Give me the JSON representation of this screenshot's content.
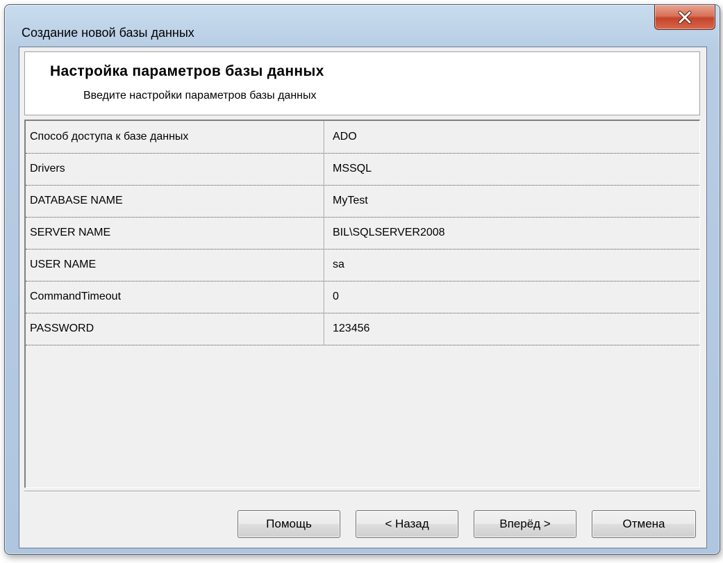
{
  "window": {
    "title": "Создание новой базы данных"
  },
  "header": {
    "title": "Настройка параметров базы данных",
    "subtitle": "Введите настройки параметров базы данных"
  },
  "parameters": [
    {
      "name": "Способ доступа к базе данных",
      "value": "ADO"
    },
    {
      "name": "Drivers",
      "value": "MSSQL"
    },
    {
      "name": "DATABASE NAME",
      "value": "MyTest"
    },
    {
      "name": "SERVER NAME",
      "value": "BIL\\SQLSERVER2008"
    },
    {
      "name": "USER NAME",
      "value": "sa"
    },
    {
      "name": "CommandTimeout",
      "value": "0"
    },
    {
      "name": "PASSWORD",
      "value": "123456"
    }
  ],
  "buttons": {
    "help": "Помощь",
    "back": "< Назад",
    "next": "Вперёд >",
    "cancel": "Отмена"
  },
  "icons": {
    "close": "close-icon"
  },
  "colors": {
    "close_button": "#c4442a",
    "client_background": "#f0f0f0",
    "header_background": "#ffffff"
  }
}
